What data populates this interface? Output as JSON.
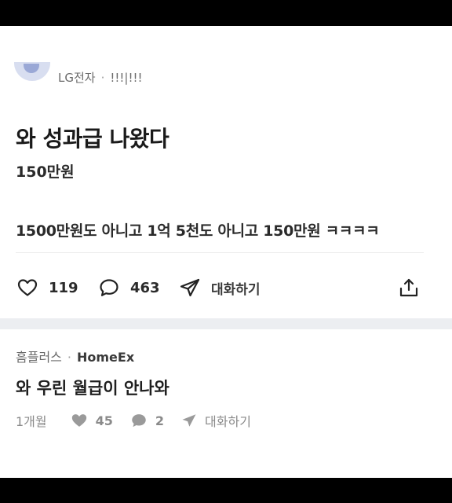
{
  "post": {
    "company": "LG전자",
    "nickname": "!!!|!!!",
    "title": "와 성과급 나왔다",
    "subtitle": "150만원",
    "body": "1500만원도 아니고 1억 5천도 아니고 150만원 ㅋㅋㅋㅋ",
    "likes": "119",
    "comments": "463",
    "share_label": "대화하기"
  },
  "reply": {
    "company": "흠플러스",
    "author": "HomeEx",
    "text": "와 우린 월급이 안나와",
    "time": "1개월",
    "likes": "45",
    "comments": "2",
    "share_label": "대화하기"
  },
  "icons": {
    "like": "heart-icon",
    "comment": "speech-bubble-icon",
    "share": "paper-plane-icon",
    "upload": "upload-icon"
  },
  "colors": {
    "background": "#ffffff",
    "letterbox": "#000000",
    "divider": "#eceef1",
    "avatar": "#d8def0"
  }
}
